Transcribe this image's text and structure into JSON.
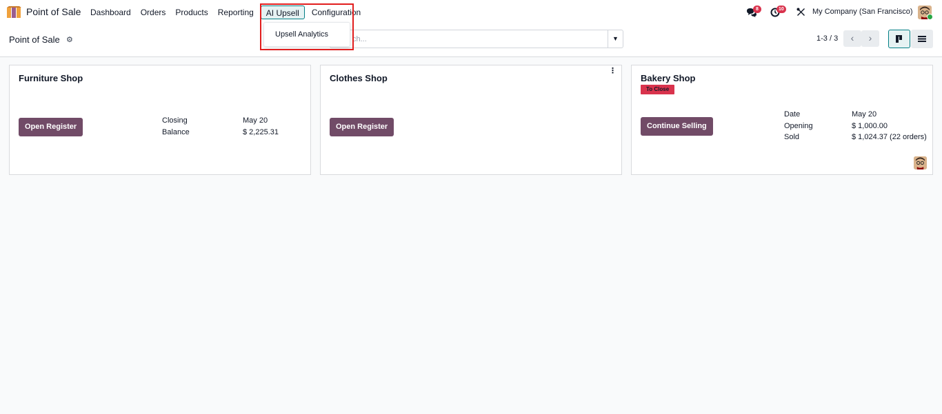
{
  "app": {
    "name": "Point of Sale"
  },
  "menu": [
    {
      "label": "Dashboard"
    },
    {
      "label": "Orders"
    },
    {
      "label": "Products"
    },
    {
      "label": "Reporting"
    },
    {
      "label": "AI Upsell"
    },
    {
      "label": "Configuration"
    }
  ],
  "dropdown": {
    "items": [
      {
        "label": "Upsell Analytics"
      }
    ]
  },
  "systray": {
    "messages_badge": "8",
    "activities_badge": "10",
    "company": "My Company (San Francisco)"
  },
  "control": {
    "title": "Point of Sale",
    "search_placeholder": "Search...",
    "search_visible_placeholder": "ch...",
    "pager": "1-3 / 3"
  },
  "cards": [
    {
      "title": "Furniture Shop",
      "button": "Open Register",
      "rows": [
        {
          "label": "Closing",
          "value": "May 20"
        },
        {
          "label": "Balance",
          "value": "$ 2,225.31"
        }
      ]
    },
    {
      "title": "Clothes Shop",
      "button": "Open Register",
      "rows": []
    },
    {
      "title": "Bakery Shop",
      "tag": "To Close",
      "button": "Continue Selling",
      "rows": [
        {
          "label": "Date",
          "value": "May 20"
        },
        {
          "label": "Opening",
          "value": "$ 1,000.00"
        },
        {
          "label": "Sold",
          "value": "$ 1,024.37 (22 orders)"
        }
      ]
    }
  ],
  "colors": {
    "primary": "#714b67",
    "accent": "#017e84",
    "danger": "#d9334d",
    "highlight": "#e11d1d"
  }
}
